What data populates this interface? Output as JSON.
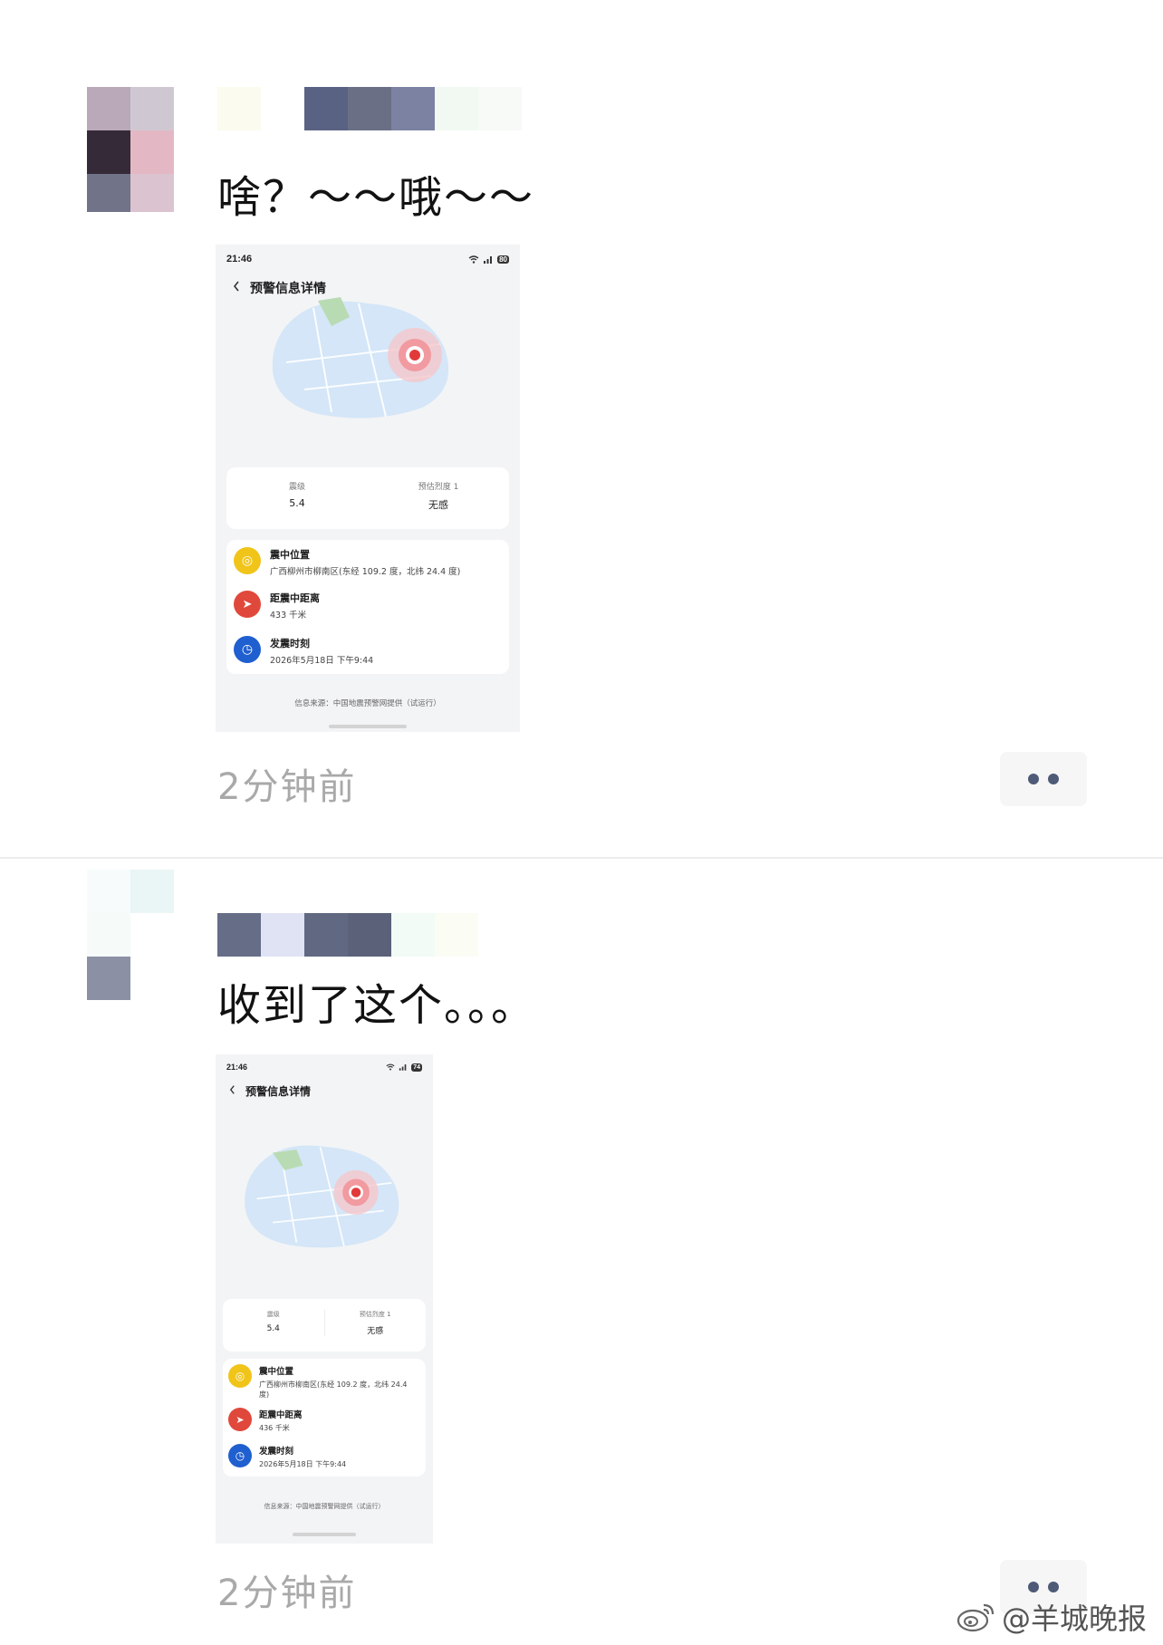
{
  "posts": [
    {
      "text": "啥？～～哦～～",
      "time": "2分钟前",
      "screenshot": {
        "clock": "21:46",
        "battery": "80",
        "title": "预警信息详情",
        "magnitude_label": "震级",
        "magnitude": "5.4",
        "intensity_label": "预估烈度 1",
        "intensity": "无感",
        "epicenter_label": "震中位置",
        "epicenter": "广西柳州市柳南区(东经 109.2 度，北纬 24.4 度)",
        "distance_label": "距震中距离",
        "distance": "433 千米",
        "time_label": "发震时刻",
        "occurred_at": "2026年5月18日 下午9:44",
        "source": "信息来源：中国地震预警网提供（试运行）"
      }
    },
    {
      "text": "收到了这个。。。",
      "time": "2分钟前",
      "screenshot": {
        "clock": "21:46",
        "battery": "74",
        "title": "预警信息详情",
        "magnitude_label": "震级",
        "magnitude": "5.4",
        "intensity_label": "预估烈度 1",
        "intensity": "无感",
        "epicenter_label": "震中位置",
        "epicenter": "广西柳州市柳南区(东经 109.2 度，北纬 24.4 度)",
        "distance_label": "距震中距离",
        "distance": "436 千米",
        "time_label": "发震时刻",
        "occurred_at": "2026年5月18日 下午9:44",
        "source": "信息来源：中国地震预警网提供（试运行）"
      }
    }
  ],
  "watermark": "@羊城晚报",
  "icons": {
    "more": "more-dots-icon",
    "back": "chevron-left-icon",
    "epicenter": "location-icon",
    "distance": "navigation-icon",
    "time": "clock-icon",
    "wifi": "wifi-icon",
    "signal": "signal-icon",
    "weibo": "weibo-logo-icon"
  },
  "colors": {
    "time_text": "#a9a9a9",
    "more_dots": "#4f5a77",
    "icon_yellow": "#f0c419",
    "icon_red": "#e0483b",
    "icon_blue": "#1f5fcf",
    "map_marker": "#e23a3a"
  }
}
